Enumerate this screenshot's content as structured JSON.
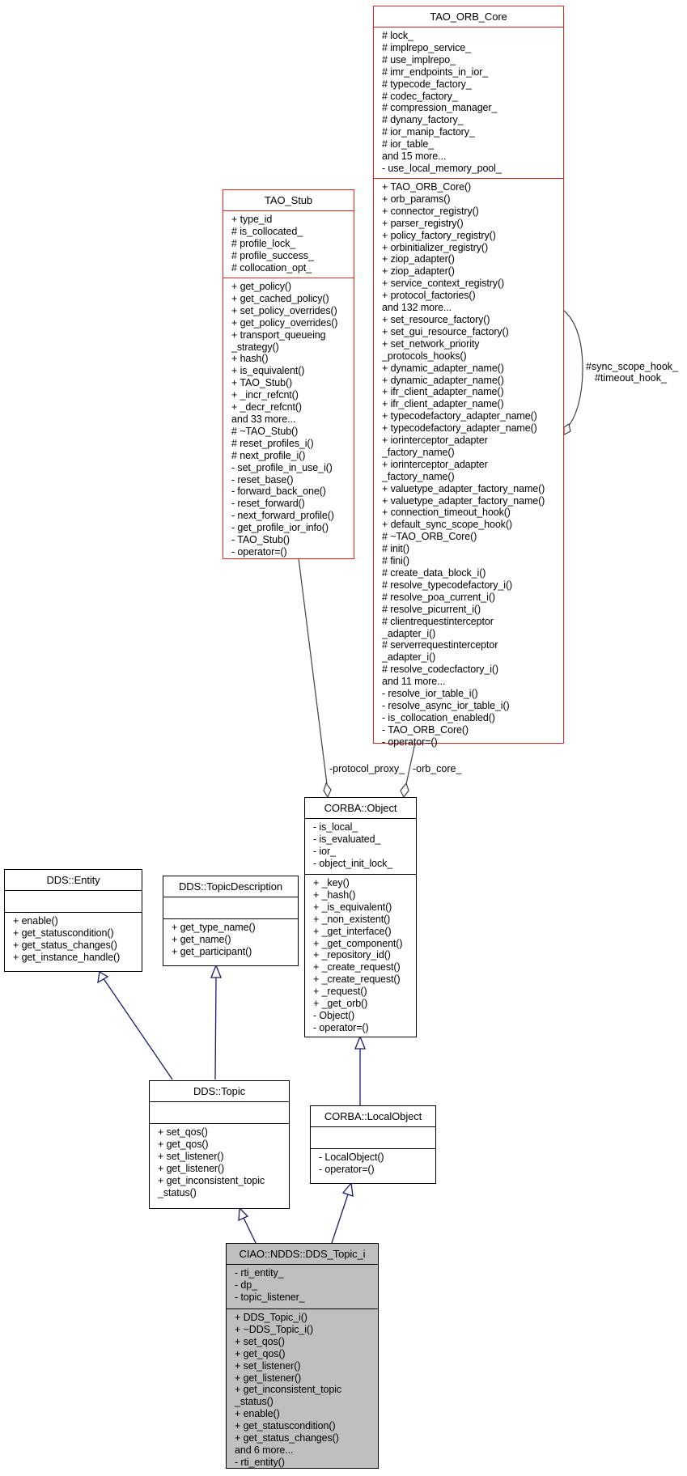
{
  "diagram": {
    "type": "uml-class-collaboration",
    "classes": {
      "tao_orb_core": {
        "name": "TAO_ORB_Core",
        "attributes": [
          "# lock_",
          "# implrepo_service_",
          "# use_implrepo_",
          "# imr_endpoints_in_ior_",
          "# typecode_factory_",
          "# codec_factory_",
          "# compression_manager_",
          "# dynany_factory_",
          "# ior_manip_factory_",
          "# ior_table_",
          "and 15 more...",
          "- use_local_memory_pool_"
        ],
        "methods": [
          "+ TAO_ORB_Core()",
          "+ orb_params()",
          "+ connector_registry()",
          "+ parser_registry()",
          "+ policy_factory_registry()",
          "+ orbinitializer_registry()",
          "+ ziop_adapter()",
          "+ ziop_adapter()",
          "+ service_context_registry()",
          "+ protocol_factories()",
          "and 132 more...",
          "+ set_resource_factory()",
          "+ set_gui_resource_factory()",
          "+ set_network_priority",
          "_protocols_hooks()",
          "+ dynamic_adapter_name()",
          "+ dynamic_adapter_name()",
          "+ ifr_client_adapter_name()",
          "+ ifr_client_adapter_name()",
          "+ typecodefactory_adapter_name()",
          "+ typecodefactory_adapter_name()",
          "+ iorinterceptor_adapter",
          "_factory_name()",
          "+ iorinterceptor_adapter",
          "_factory_name()",
          "+ valuetype_adapter_factory_name()",
          "+ valuetype_adapter_factory_name()",
          "+ connection_timeout_hook()",
          "+ default_sync_scope_hook()",
          "# ~TAO_ORB_Core()",
          "# init()",
          "# fini()",
          "# create_data_block_i()",
          "# resolve_typecodefactory_i()",
          "# resolve_poa_current_i()",
          "# resolve_picurrent_i()",
          "# clientrequestinterceptor",
          "_adapter_i()",
          "# serverrequestinterceptor",
          "_adapter_i()",
          "# resolve_codecfactory_i()",
          "and 11 more...",
          "- resolve_ior_table_i()",
          "- resolve_async_ior_table_i()",
          "- is_collocation_enabled()",
          "- TAO_ORB_Core()",
          "- operator=()"
        ]
      },
      "tao_stub": {
        "name": "TAO_Stub",
        "attributes": [
          "+ type_id",
          "# is_collocated_",
          "# profile_lock_",
          "# profile_success_",
          "# collocation_opt_"
        ],
        "methods": [
          "+ get_policy()",
          "+ get_cached_policy()",
          "+ set_policy_overrides()",
          "+ get_policy_overrides()",
          "+ transport_queueing",
          "_strategy()",
          "+ hash()",
          "+ is_equivalent()",
          "+ TAO_Stub()",
          "+ _incr_refcnt()",
          "+ _decr_refcnt()",
          "and 33 more...",
          "# ~TAO_Stub()",
          "# reset_profiles_i()",
          "# next_profile_i()",
          "- set_profile_in_use_i()",
          "- reset_base()",
          "- forward_back_one()",
          "- reset_forward()",
          "- next_forward_profile()",
          "- get_profile_ior_info()",
          "- TAO_Stub()",
          "- operator=()"
        ]
      },
      "corba_object": {
        "name": "CORBA::Object",
        "attributes": [
          "- is_local_",
          "- is_evaluated_",
          "- ior_",
          "- object_init_lock_"
        ],
        "methods": [
          "+ _key()",
          "+ _hash()",
          "+ _is_equivalent()",
          "+ _non_existent()",
          "+ _get_interface()",
          "+ _get_component()",
          "+ _repository_id()",
          "+ _create_request()",
          "+ _create_request()",
          "+ _request()",
          "+ _get_orb()",
          "- Object()",
          "- operator=()"
        ]
      },
      "dds_entity": {
        "name": "DDS::Entity",
        "attributes": [],
        "methods": [
          "+ enable()",
          "+ get_statuscondition()",
          "+ get_status_changes()",
          "+ get_instance_handle()"
        ]
      },
      "dds_topic_description": {
        "name": "DDS::TopicDescription",
        "attributes": [],
        "methods": [
          "+ get_type_name()",
          "+ get_name()",
          "+ get_participant()"
        ]
      },
      "dds_topic": {
        "name": "DDS::Topic",
        "attributes": [],
        "methods": [
          "+ set_qos()",
          "+ get_qos()",
          "+ set_listener()",
          "+ get_listener()",
          "+ get_inconsistent_topic",
          "_status()"
        ]
      },
      "corba_local_object": {
        "name": "CORBA::LocalObject",
        "attributes": [],
        "methods": [
          "- LocalObject()",
          "- operator=()"
        ]
      },
      "ciao_dds_topic_i": {
        "name": "CIAO::NDDS::DDS_Topic_i",
        "attributes": [
          "- rti_entity_",
          "- dp_",
          "- topic_listener_"
        ],
        "methods": [
          "+ DDS_Topic_i()",
          "+ ~DDS_Topic_i()",
          "+ set_qos()",
          "+ get_qos()",
          "+ set_listener()",
          "+ get_listener()",
          "+ get_inconsistent_topic",
          "_status()",
          "+ enable()",
          "+ get_statuscondition()",
          "+ get_status_changes()",
          "and 6 more...",
          "- rti_entity()"
        ]
      }
    },
    "edge_labels": {
      "protocol_proxy": "-protocol_proxy_",
      "orb_core": "-orb_core_",
      "self_loop_1": "#sync_scope_hook_",
      "self_loop_2": "#timeout_hook_"
    },
    "relations": [
      {
        "from": "dds_entity",
        "to": "dds_topic",
        "kind": "inheritance"
      },
      {
        "from": "dds_topic_description",
        "to": "dds_topic",
        "kind": "inheritance"
      },
      {
        "from": "corba_object",
        "to": "corba_local_object",
        "kind": "inheritance"
      },
      {
        "from": "dds_topic",
        "to": "ciao_dds_topic_i",
        "kind": "inheritance"
      },
      {
        "from": "corba_local_object",
        "to": "ciao_dds_topic_i",
        "kind": "inheritance"
      },
      {
        "from": "tao_stub",
        "to": "corba_object",
        "kind": "aggregation",
        "label": "-protocol_proxy_"
      },
      {
        "from": "tao_orb_core",
        "to": "corba_object",
        "kind": "aggregation",
        "label": "-orb_core_"
      },
      {
        "from": "tao_orb_core",
        "to": "tao_orb_core",
        "kind": "aggregation",
        "label": "#sync_scope_hook_ #timeout_hook_"
      }
    ],
    "colors": {
      "inheritance_edge": "#191970",
      "aggregation_edge": "#404040",
      "external_class_border": "#e8221e",
      "focus_class_fill": "#bfbfbf"
    }
  }
}
